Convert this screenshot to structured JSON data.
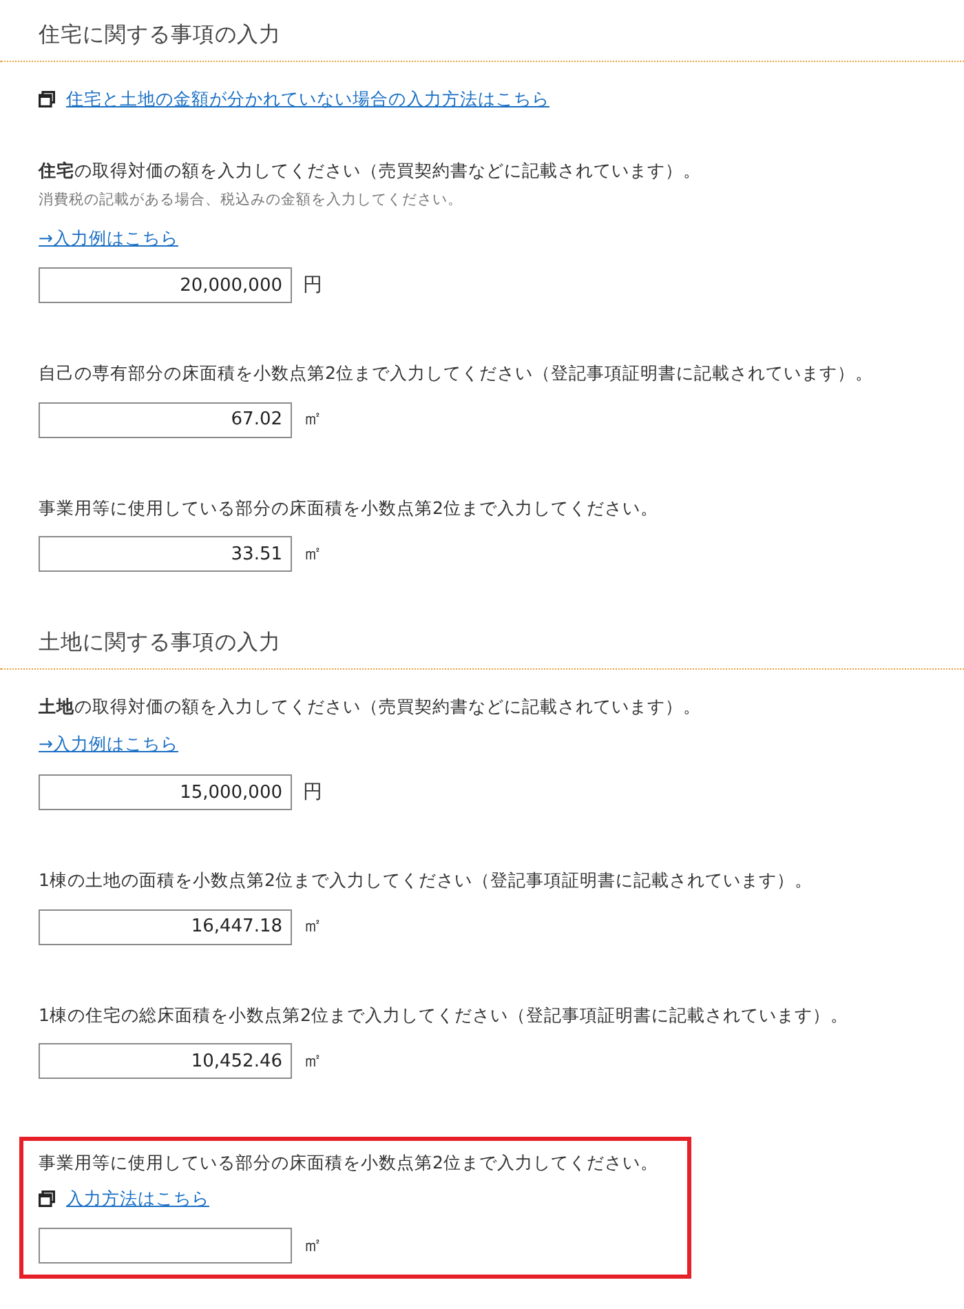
{
  "sections": [
    {
      "title": "住宅に関する事項の入力",
      "window_link": "住宅と土地の金額が分かれていない場合の入力方法はこちら",
      "fields": [
        {
          "question": "**住宅**の取得対価の額を入力してください（売買契約書などに記載されています）。",
          "note": "消費税の記載がある場合、税込みの金額を入力してください。",
          "example_link": "→入力例はこちら",
          "value": "20,000,000",
          "unit": "円",
          "highlighted": false
        },
        {
          "question": "自己の専有部分の床面積を小数点第2位まで入力してください（登記事項証明書に記載されています）。",
          "value": "67.02",
          "unit": "㎡",
          "highlighted": false
        },
        {
          "question": "事業用等に使用している部分の床面積を小数点第2位まで入力してください。",
          "value": "33.51",
          "unit": "㎡",
          "highlighted": false
        }
      ]
    },
    {
      "title": "土地に関する事項の入力",
      "fields": [
        {
          "question": "**土地**の取得対価の額を入力してください（売買契約書などに記載されています）。",
          "example_link": "→入力例はこちら",
          "value": "15,000,000",
          "unit": "円",
          "highlighted": false
        },
        {
          "question": "1棟の土地の面積を小数点第2位まで入力してください（登記事項証明書に記載されています）。",
          "value": "16,447.18",
          "unit": "㎡",
          "highlighted": false
        },
        {
          "question": "1棟の住宅の総床面積を小数点第2位まで入力してください（登記事項証明書に記載されています）。",
          "value": "10,452.46",
          "unit": "㎡",
          "highlighted": false
        },
        {
          "question": "事業用等に使用している部分の床面積を小数点第2位まで入力してください。",
          "howto_link": "入力方法はこちら",
          "unit": "㎡",
          "highlighted": true
        }
      ]
    }
  ]
}
